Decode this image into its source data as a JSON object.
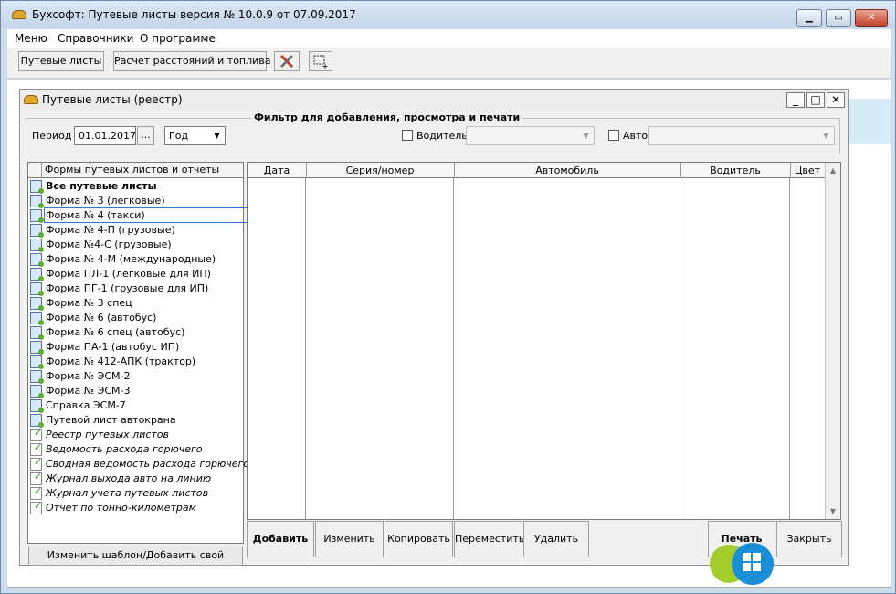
{
  "app": {
    "title": "Бухсофт: Путевые листы версия № 10.0.9 от 07.09.2017",
    "caption_buttons": {
      "minimize": "▁",
      "maximize": "▭",
      "close": "✕"
    }
  },
  "menu": [
    "Меню",
    "Справочники",
    "О программе"
  ],
  "toolbar": {
    "waybills_label": "Путевые листы",
    "calc_label": "Расчет расстояний и топлива",
    "tools_icon": "wrench-screwdriver-icon",
    "select_icon": "selection-add-icon"
  },
  "child": {
    "title": "Путевые листы (реестр)",
    "caption_buttons": {
      "minimize": "_",
      "maximize": "□",
      "close": "✕"
    }
  },
  "filter": {
    "legend": "Фильтр для добавления, просмотра и печати",
    "period_label": "Период",
    "period_date": "01.01.2017",
    "period_button": "...",
    "period_type": "Год",
    "driver_label": "Водитель",
    "driver_value": "",
    "auto_label": "Авто",
    "auto_value": ""
  },
  "tree": {
    "header": "Формы путевых листов и отчеты",
    "items": [
      {
        "label": "Все путевые листы",
        "style": "bold",
        "icon": "form-icon"
      },
      {
        "label": "Форма № 3 (легковые)",
        "style": "normal",
        "icon": "form-icon"
      },
      {
        "label": "Форма № 4 (такси)",
        "style": "selected",
        "icon": "form-icon"
      },
      {
        "label": "Форма № 4-П (грузовые)",
        "style": "normal",
        "icon": "form-icon"
      },
      {
        "label": "Форма №4-С (грузовые)",
        "style": "normal",
        "icon": "form-icon"
      },
      {
        "label": "Форма № 4-М (международные)",
        "style": "normal",
        "icon": "form-icon"
      },
      {
        "label": "Форма ПЛ-1 (легковые для ИП)",
        "style": "normal",
        "icon": "form-icon"
      },
      {
        "label": "Форма ПГ-1 (грузовые для ИП)",
        "style": "normal",
        "icon": "form-icon"
      },
      {
        "label": "Форма № 3 спец",
        "style": "normal",
        "icon": "form-icon"
      },
      {
        "label": "Форма № 6 (автобус)",
        "style": "normal",
        "icon": "form-icon"
      },
      {
        "label": "Форма № 6 спец (автобус)",
        "style": "normal",
        "icon": "form-icon"
      },
      {
        "label": "Форма ПА-1 (автобус ИП)",
        "style": "normal",
        "icon": "form-icon"
      },
      {
        "label": "Форма № 412-АПК (трактор)",
        "style": "normal",
        "icon": "form-icon"
      },
      {
        "label": "Форма № ЭСМ-2",
        "style": "normal",
        "icon": "form-icon"
      },
      {
        "label": "Форма № ЭСМ-3",
        "style": "normal",
        "icon": "form-icon"
      },
      {
        "label": "Справка ЭСМ-7",
        "style": "normal",
        "icon": "form-icon"
      },
      {
        "label": "Путевой лист автокрана",
        "style": "normal",
        "icon": "form-icon"
      },
      {
        "label": "Реестр путевых листов",
        "style": "italic",
        "icon": "report-icon"
      },
      {
        "label": "Ведомость расхода горючего",
        "style": "italic",
        "icon": "report-icon"
      },
      {
        "label": "Сводная ведомость расхода горючего",
        "style": "italic",
        "icon": "report-icon"
      },
      {
        "label": "Журнал выхода авто на линию",
        "style": "italic",
        "icon": "report-icon"
      },
      {
        "label": "Журнал учета путевых листов",
        "style": "italic",
        "icon": "report-icon"
      },
      {
        "label": "Отчет по тонно-километрам",
        "style": "italic",
        "icon": "report-icon"
      }
    ],
    "template_button": "Изменить шаблон/Добавить свой"
  },
  "grid": {
    "columns": [
      "Дата",
      "Серия/номер",
      "Автомобиль",
      "Водитель",
      "Цвет"
    ],
    "rows": [],
    "scroll_up": "▲",
    "scroll_down": "▼"
  },
  "actions": {
    "add": "Добавить",
    "edit": "Изменить",
    "copy": "Копировать",
    "move": "Переместить",
    "delete": "Удалить",
    "print": "Печать",
    "close": "Закрыть"
  },
  "colors": {
    "window_frame": "#cfdcec",
    "client_band": "#d5ebf5",
    "selection_outline": "#3276c8",
    "android_badge": "#a4cc2c",
    "windows_badge": "#1a8fd8"
  }
}
